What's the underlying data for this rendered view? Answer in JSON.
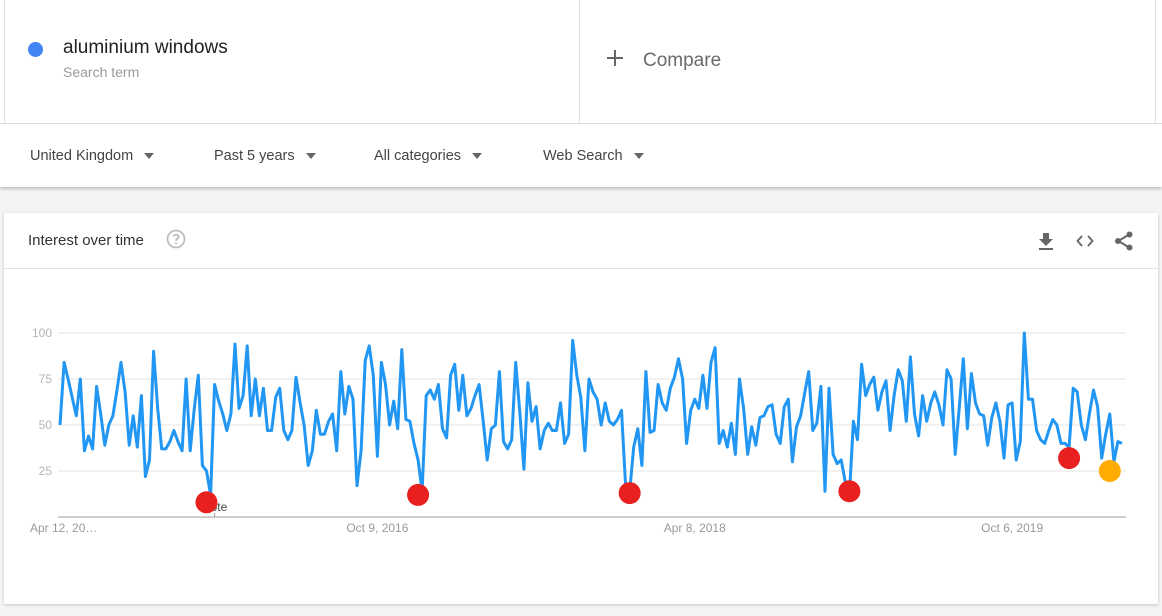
{
  "search_term": {
    "name": "aluminium windows",
    "subtitle": "Search term",
    "color": "#4285f4"
  },
  "compare": {
    "icon": "plus-icon",
    "label": "Compare"
  },
  "filters": [
    {
      "label": "United Kingdom",
      "icon": "caret-down-icon"
    },
    {
      "label": "Past 5 years",
      "icon": "caret-down-icon"
    },
    {
      "label": "All categories",
      "icon": "caret-down-icon"
    },
    {
      "label": "Web Search",
      "icon": "caret-down-icon"
    }
  ],
  "card": {
    "title": "Interest over time",
    "icons": [
      "help-icon",
      "download-icon",
      "embed-icon",
      "share-icon"
    ]
  },
  "chart_data": {
    "type": "line",
    "title": "Interest over time",
    "xlabel": "",
    "ylabel": "",
    "ylim": [
      0,
      100
    ],
    "grid": true,
    "y_ticks": [
      25,
      50,
      75,
      100
    ],
    "x_ticks": [
      {
        "label": "Apr 12, 20…",
        "index": 0,
        "align": "start"
      },
      {
        "label": "Oct 9, 2016",
        "index": 78,
        "align": "middle"
      },
      {
        "label": "Apr 8, 2018",
        "index": 156,
        "align": "middle"
      },
      {
        "label": "Oct 6, 2019",
        "index": 234,
        "align": "middle"
      }
    ],
    "series": [
      {
        "name": "aluminium windows",
        "color": "#2196f3",
        "values": [
          50,
          84,
          75,
          65,
          55,
          75,
          36,
          44,
          37,
          71,
          56,
          39,
          50,
          55,
          69,
          84,
          68,
          39,
          55,
          38,
          66,
          22,
          31,
          90,
          59,
          37,
          37,
          41,
          47,
          41,
          36,
          75,
          36,
          59,
          77,
          28,
          25,
          12,
          72,
          63,
          56,
          47,
          56,
          94,
          59,
          66,
          93,
          55,
          75,
          55,
          70,
          47,
          47,
          65,
          70,
          47,
          42,
          47,
          76,
          62,
          50,
          28,
          36,
          58,
          45,
          45,
          52,
          56,
          36,
          79,
          56,
          71,
          64,
          17,
          36,
          85,
          93,
          77,
          33,
          84,
          72,
          50,
          63,
          48,
          91,
          53,
          52,
          40,
          31,
          14,
          66,
          69,
          64,
          72,
          48,
          43,
          77,
          83,
          58,
          77,
          55,
          59,
          66,
          72,
          52,
          31,
          48,
          50,
          79,
          41,
          37,
          42,
          84,
          57,
          26,
          73,
          52,
          60,
          37,
          47,
          51,
          47,
          47,
          62,
          40,
          45,
          96,
          77,
          65,
          36,
          75,
          68,
          64,
          50,
          62,
          52,
          50,
          53,
          58,
          17,
          14,
          38,
          48,
          28,
          79,
          46,
          47,
          72,
          62,
          58,
          70,
          76,
          86,
          75,
          40,
          58,
          64,
          59,
          77,
          59,
          84,
          92,
          40,
          47,
          38,
          51,
          34,
          75,
          59,
          34,
          49,
          39,
          54,
          55,
          60,
          61,
          45,
          40,
          60,
          64,
          30,
          49,
          55,
          67,
          79,
          47,
          51,
          71,
          14,
          70,
          34,
          29,
          31,
          19,
          12,
          52,
          42,
          83,
          66,
          72,
          76,
          58,
          68,
          74,
          47,
          66,
          80,
          74,
          52,
          87,
          56,
          44,
          66,
          52,
          62,
          68,
          61,
          50,
          80,
          75,
          34,
          59,
          86,
          48,
          78,
          62,
          56,
          55,
          39,
          54,
          62,
          52,
          32,
          61,
          62,
          31,
          41,
          100,
          64,
          64,
          47,
          42,
          40,
          47,
          53,
          50,
          40,
          40,
          38,
          70,
          68,
          50,
          42,
          56,
          69,
          60,
          32,
          45,
          56,
          30,
          41,
          40
        ]
      }
    ],
    "note_marker": {
      "label": "Note",
      "index": 38
    },
    "markers": [
      {
        "index": 36,
        "value": 8,
        "color": "#e8201f"
      },
      {
        "index": 88,
        "value": 12,
        "color": "#e8201f"
      },
      {
        "index": 140,
        "value": 13,
        "color": "#e8201f"
      },
      {
        "index": 194,
        "value": 14,
        "color": "#e8201f"
      },
      {
        "index": 248,
        "value": 32,
        "color": "#e8201f"
      },
      {
        "index": 258,
        "value": 25,
        "color": "#ffab00"
      }
    ]
  }
}
